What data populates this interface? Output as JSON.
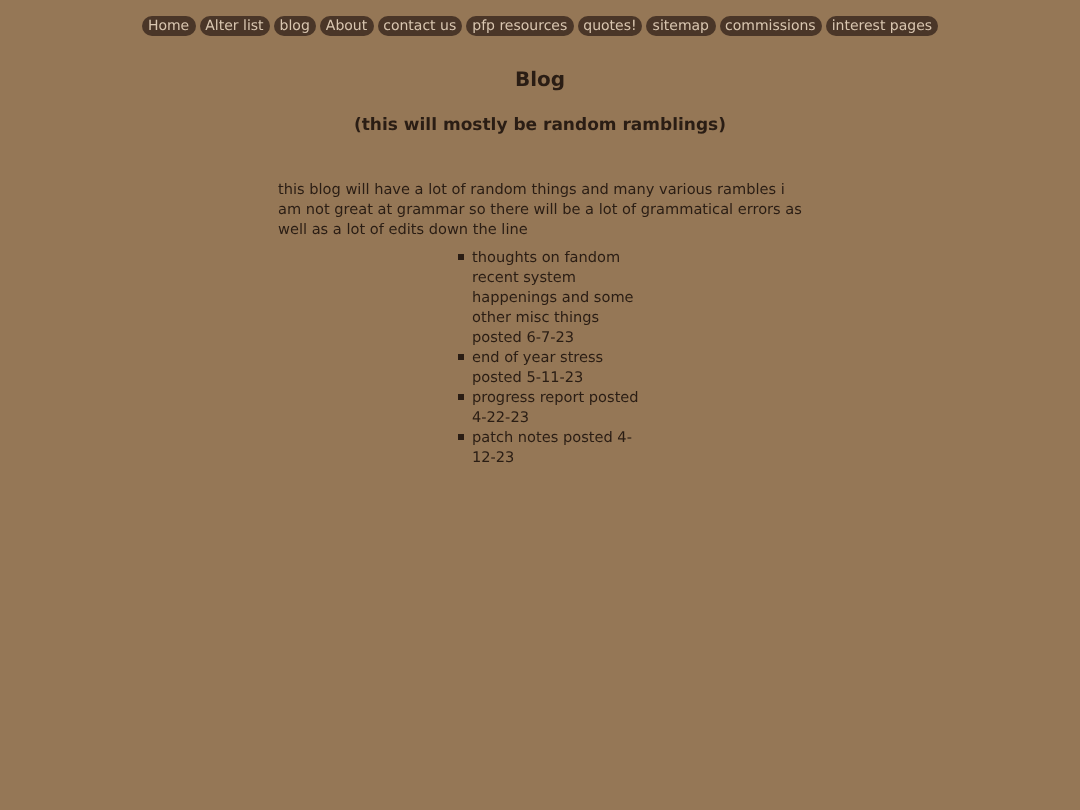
{
  "nav": [
    "Home",
    "Alter list",
    "blog",
    "About",
    "contact us",
    "pfp resources",
    "quotes!",
    "sitemap",
    "commissions",
    "interest pages"
  ],
  "title": "Blog",
  "subtitle": "(this will mostly be random ramblings)",
  "intro": "this blog will have a lot of random things and many various rambles i am not great at grammar so there will be a lot of grammatical errors as well as a lot of edits down the line",
  "posts": [
    "thoughts on fandom recent system happenings and some other misc things posted 6-7-23",
    "end of year stress posted 5-11-23",
    "progress report posted 4-22-23",
    "patch notes posted 4-12-23"
  ]
}
